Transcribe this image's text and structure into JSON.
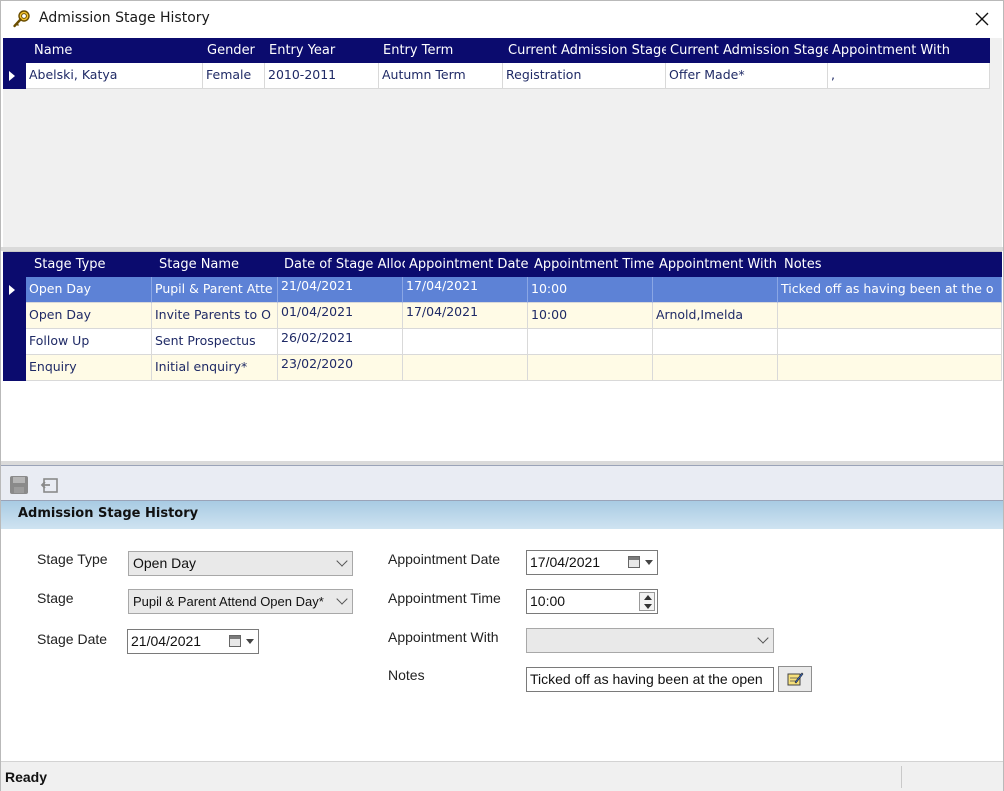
{
  "window": {
    "title": "Admission Stage History",
    "icon": "magnifier-key-icon",
    "close_glyph": "✕"
  },
  "pupil_grid": {
    "columns": [
      "Name",
      "Gender",
      "Entry Year",
      "Entry Term",
      "Current Admission Stage",
      "Current Admission Stage",
      "Appointment With"
    ],
    "rows": [
      [
        "Abelski, Katya",
        "Female",
        "2010-2011",
        "Autumn Term",
        "Registration",
        "Offer Made*",
        ","
      ]
    ]
  },
  "stage_grid": {
    "columns": [
      "Stage Type",
      "Stage Name",
      "Date of Stage Alloc",
      "Appointment Date",
      "Appointment Time",
      "Appointment With",
      "Notes"
    ],
    "rows": [
      [
        "Open Day",
        "Pupil & Parent Atte",
        "21/04/2021",
        "17/04/2021",
        "10:00",
        "",
        "Ticked off as having been at the o"
      ],
      [
        "Open Day",
        "Invite Parents to O",
        "01/04/2021",
        "17/04/2021",
        "10:00",
        "Arnold,Imelda",
        ""
      ],
      [
        "Follow Up",
        "Sent Prospectus",
        "26/02/2021",
        "",
        "",
        "",
        ""
      ],
      [
        "Enquiry",
        "Initial enquiry*",
        "23/02/2020",
        "",
        "",
        "",
        ""
      ]
    ],
    "selected_row": 0
  },
  "toolbar": {
    "save_icon": "save-icon",
    "undo_icon": "undo-icon"
  },
  "panel": {
    "title": "Admission Stage History"
  },
  "form": {
    "stage_type_label": "Stage Type",
    "stage_type_value": "Open Day",
    "stage_label": "Stage",
    "stage_value": "Pupil & Parent Attend Open Day*",
    "stage_date_label": "Stage Date",
    "stage_date_value": "21/04/2021",
    "appointment_date_label": "Appointment Date",
    "appointment_date_value": "17/04/2021",
    "appointment_time_label": "Appointment Time",
    "appointment_time_value": "10:00",
    "appointment_with_label": "Appointment With",
    "appointment_with_value": "",
    "notes_label": "Notes",
    "notes_value": "Ticked off as having been at the open"
  },
  "status": {
    "text": "Ready"
  },
  "colors": {
    "grid_header": "#0b0b6e",
    "selected_row": "#5d82d6",
    "alt_row": "#fffbe6",
    "panel_header": "#a8cbe3"
  }
}
